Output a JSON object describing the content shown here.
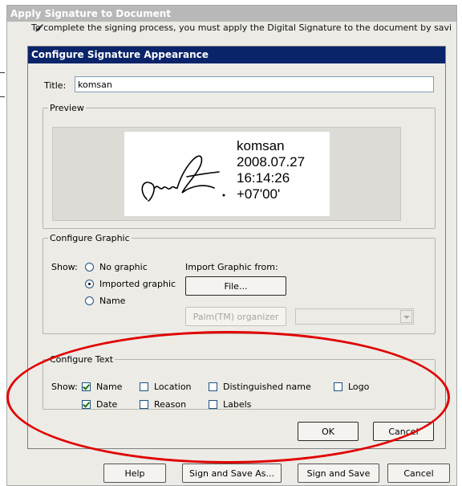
{
  "background_window": {
    "title": "Apply Signature to Document",
    "intro_text": "To complete the signing process, you must apply the Digital Signature to the document by saving",
    "buttons": {
      "help": "Help",
      "sign_and_save_as": "Sign and Save As...",
      "sign_and_save": "Sign and Save",
      "cancel": "Cancel"
    }
  },
  "dialog": {
    "title": "Configure Signature Appearance",
    "title_field": {
      "label": "Title:",
      "value": "komsan"
    },
    "preview": {
      "legend": "Preview",
      "signature_lines": [
        "komsan",
        "2008.07.27",
        "16:14:26",
        "+07'00'"
      ]
    },
    "configure_graphic": {
      "legend": "Configure Graphic",
      "show_label": "Show:",
      "options": [
        {
          "label": "No graphic",
          "selected": false
        },
        {
          "label": "Imported graphic",
          "selected": true
        },
        {
          "label": "Name",
          "selected": false
        }
      ],
      "import_label": "Import Graphic from:",
      "file_button": "File...",
      "palm_button": "Palm(TM) organizer",
      "palm_select_value": ""
    },
    "configure_text": {
      "legend": "Configure Text",
      "show_label": "Show:",
      "checkboxes": [
        {
          "label": "Name",
          "checked": true
        },
        {
          "label": "Location",
          "checked": false
        },
        {
          "label": "Distinguished name",
          "checked": false
        },
        {
          "label": "Logo",
          "checked": false
        },
        {
          "label": "Date",
          "checked": true
        },
        {
          "label": "Reason",
          "checked": false
        },
        {
          "label": "Labels",
          "checked": false
        }
      ]
    },
    "ok_button": "OK",
    "cancel_button": "Cancel"
  },
  "colors": {
    "dialog_title_bar": "#0a246a",
    "annotation_ellipse": "#e00000"
  }
}
